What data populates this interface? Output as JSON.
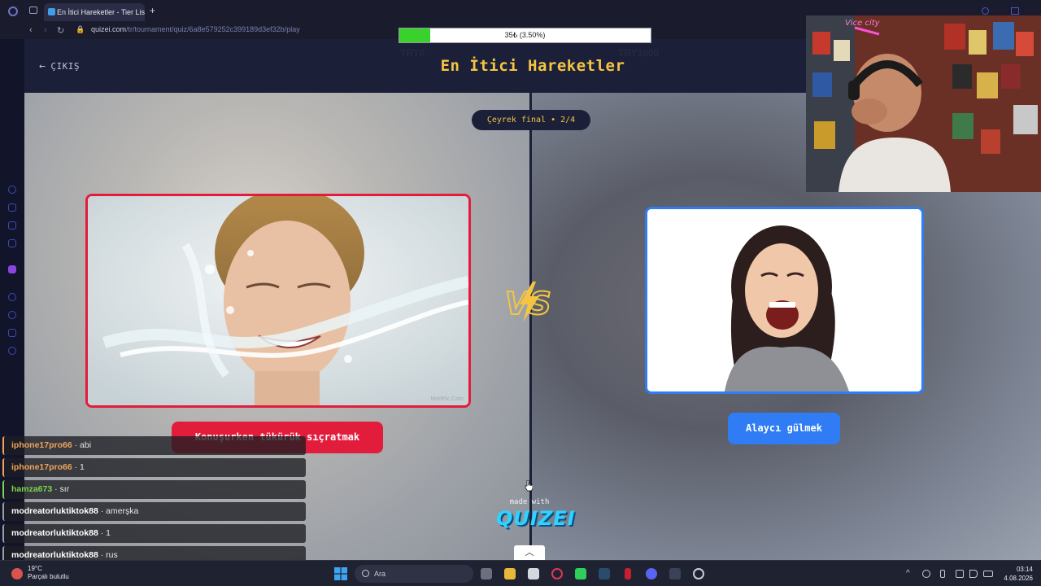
{
  "browser": {
    "tab_title": "En İtici Hareketler - Tier List",
    "url_domain": "quizei.com",
    "url_path": "/tr/tournament/quiz/6a8e579252c399189d3ef32b/play",
    "new_tab_icon": "plus-icon"
  },
  "header": {
    "exit_label": "ÇIKIŞ",
    "title": "En İtici Hareketler"
  },
  "tournament": {
    "round_label": "Çeyrek final • 2/4",
    "left_option": "Konuşurken tükürük sıçratmak",
    "right_option": "Alaycı gülmek",
    "left_image_watermark": "MortPic.Com"
  },
  "branding": {
    "made_with": "made with",
    "logo_text": "QUIZEI"
  },
  "donation": {
    "text": "35₺ (3.50%)",
    "progress": 0.035,
    "min_label": "TRY0",
    "max_label": "TRY1000"
  },
  "chat": [
    {
      "user": "iphone17pro66",
      "message": "abi",
      "color": "#f0a45a"
    },
    {
      "user": "iphone17pro66",
      "message": "1",
      "color": "#f0a45a"
    },
    {
      "user": "hamza673",
      "message": "sır",
      "color": "#7bd54e"
    },
    {
      "user": "modreatorluktiktok88",
      "message": "amerşka",
      "color": "#ffffff"
    },
    {
      "user": "modreatorluktiktok88",
      "message": "1",
      "color": "#ffffff"
    },
    {
      "user": "modreatorluktiktok88",
      "message": "rus",
      "color": "#ffffff"
    }
  ],
  "taskbar": {
    "weather_temp": "19°C",
    "weather_desc": "Parçalı bulutlu",
    "search_label": "Ara",
    "time": "03:14",
    "date": "4.08.2026"
  },
  "colors": {
    "accent_yellow": "#f5c542",
    "left_red": "#e21d3c",
    "right_blue": "#2f7cf4",
    "header_bg": "#1b2038"
  }
}
